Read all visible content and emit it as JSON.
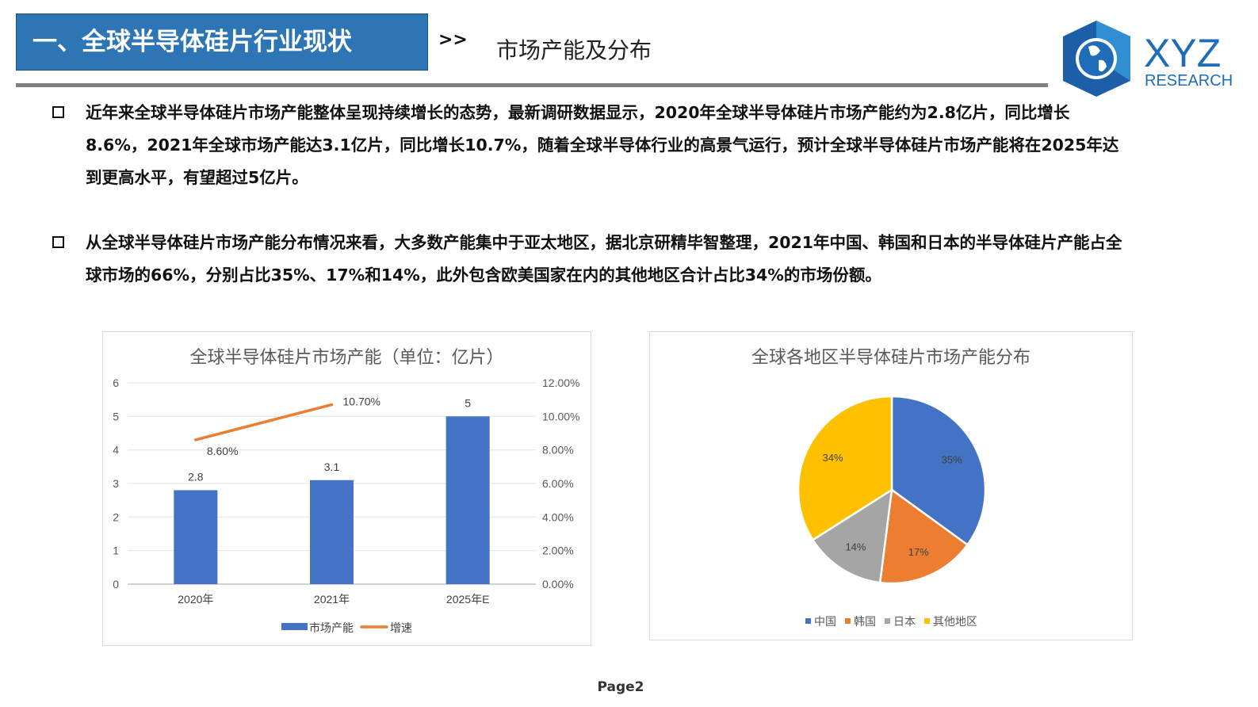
{
  "header": {
    "title": "一、全球半导体硅片行业现状",
    "arrows": ">>",
    "subtitle": "市场产能及分布"
  },
  "logo": {
    "name": "XYZ",
    "sub": "RESEARCH"
  },
  "paragraphs": [
    "近年来全球半导体硅片市场产能整体呈现持续增长的态势，最新调研数据显示，2020年全球半导体硅片市场产能约为2.8亿片，同比增长8.6%，2021年全球市场产能达3.1亿片，同比增长10.7%，随着全球半导体行业的高景气运行，预计全球半导体硅片市场产能将在2025年达到更高水平，有望超过5亿片。",
    "从全球半导体硅片市场产能分布情况来看，大多数产能集中于亚太地区，据北京研精毕智整理，2021年中国、韩国和日本的半导体硅片产能占全球市场的66%，分别占比35%、17%和14%，此外包含欧美国家在内的其他地区合计占比34%的市场份额。"
  ],
  "chart_data": [
    {
      "type": "bar",
      "title": "全球半导体硅片市场产能（单位：亿片）",
      "categories": [
        "2020年",
        "2021年",
        "2025年E"
      ],
      "series": [
        {
          "name": "市场产能",
          "values": [
            2.8,
            3.1,
            5
          ],
          "labels": [
            "2.8",
            "3.1",
            "5"
          ],
          "color": "#4472C4",
          "axis": "left"
        },
        {
          "name": "增速",
          "type": "line",
          "values": [
            8.6,
            10.7,
            null
          ],
          "labels": [
            "8.60%",
            "10.70%",
            ""
          ],
          "color": "#ED7D31",
          "axis": "right"
        }
      ],
      "ylim": [
        0,
        6
      ],
      "yticks": [
        "0",
        "1",
        "2",
        "3",
        "4",
        "5",
        "6"
      ],
      "y2lim": [
        0,
        12
      ],
      "y2ticks": [
        "0.00%",
        "2.00%",
        "4.00%",
        "6.00%",
        "8.00%",
        "10.00%",
        "12.00%"
      ],
      "legend": "bottom",
      "grid": true
    },
    {
      "type": "pie",
      "title": "全球各地区半导体硅片市场产能分布",
      "labels": [
        "中国",
        "韩国",
        "日本",
        "其他地区"
      ],
      "values": [
        35,
        17,
        14,
        34
      ],
      "value_labels": [
        "35%",
        "17%",
        "14%",
        "34%"
      ],
      "colors": [
        "#4472C4",
        "#ED7D31",
        "#A5A5A5",
        "#FFC000"
      ],
      "legend": "bottom"
    }
  ],
  "footer": {
    "page": "Page2"
  }
}
